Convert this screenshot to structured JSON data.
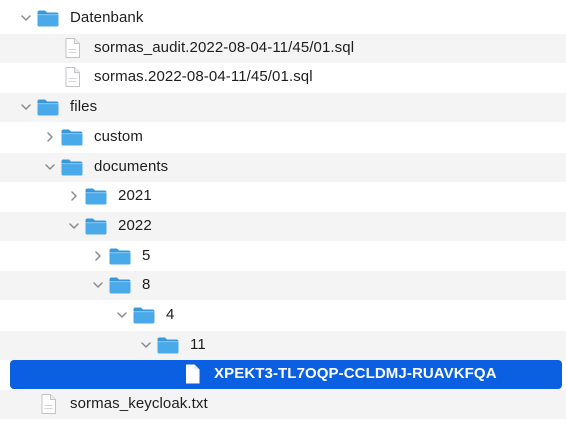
{
  "tree": {
    "rows": [
      {
        "depth": 0,
        "kind": "folder",
        "expanded": true,
        "label": "Datenbank"
      },
      {
        "depth": 1,
        "kind": "file",
        "label": "sormas_audit.2022-08-04-11/45/01.sql"
      },
      {
        "depth": 1,
        "kind": "file",
        "label": "sormas.2022-08-04-11/45/01.sql"
      },
      {
        "depth": 0,
        "kind": "folder",
        "expanded": true,
        "label": "files"
      },
      {
        "depth": 1,
        "kind": "folder",
        "expanded": false,
        "label": "custom"
      },
      {
        "depth": 1,
        "kind": "folder",
        "expanded": true,
        "label": "documents"
      },
      {
        "depth": 2,
        "kind": "folder",
        "expanded": false,
        "label": "2021"
      },
      {
        "depth": 2,
        "kind": "folder",
        "expanded": true,
        "label": "2022"
      },
      {
        "depth": 3,
        "kind": "folder",
        "expanded": false,
        "label": "5"
      },
      {
        "depth": 3,
        "kind": "folder",
        "expanded": true,
        "label": "8"
      },
      {
        "depth": 4,
        "kind": "folder",
        "expanded": true,
        "label": "4"
      },
      {
        "depth": 5,
        "kind": "folder",
        "expanded": true,
        "label": "11"
      },
      {
        "depth": 6,
        "kind": "file",
        "selected": true,
        "label": "XPEKT3-TL7OQP-CCLDMJ-RUAVKFQA"
      },
      {
        "depth": 0,
        "kind": "file",
        "label": "sormas_keycloak.txt"
      }
    ]
  },
  "colors": {
    "folder": "#4aa9e8",
    "folder_tab": "#3b98d8",
    "selection": "#0a60e0",
    "stripe": "#f4f4f5",
    "chevron": "#8a8a8e"
  },
  "icons": {
    "folder": "folder-icon",
    "file": "document-icon",
    "chevron_expanded": "chevron-down-icon",
    "chevron_collapsed": "chevron-right-icon"
  }
}
